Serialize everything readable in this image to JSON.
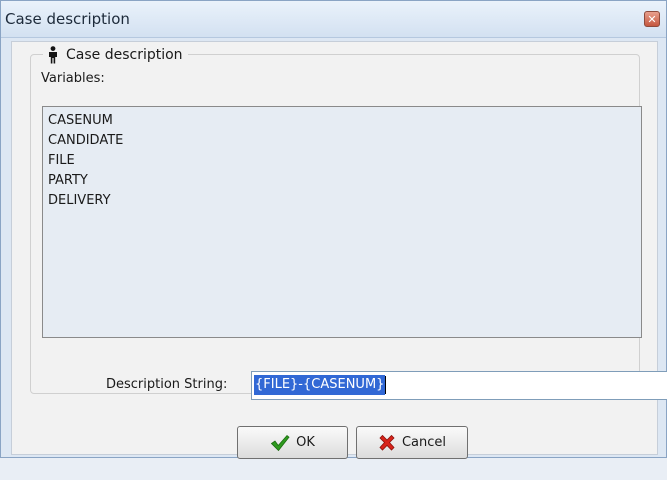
{
  "window": {
    "title": "Case description",
    "close_glyph": "✕"
  },
  "group": {
    "title": "Case description",
    "icon": "person-icon"
  },
  "variables": {
    "label": "Variables:",
    "items": [
      "CASENUM",
      "CANDIDATE",
      "FILE",
      "PARTY",
      "DELIVERY"
    ]
  },
  "description": {
    "label": "Description String:",
    "value": "{FILE}-{CASENUM}",
    "selected": true
  },
  "buttons": {
    "ok": {
      "label": "OK",
      "icon": "checkmark-icon"
    },
    "cancel": {
      "label": "Cancel",
      "icon": "red-x-icon"
    }
  },
  "colors": {
    "selection": "#3168d5",
    "title_bar": "#dae6f4",
    "list_bg": "#e6ecf3"
  }
}
